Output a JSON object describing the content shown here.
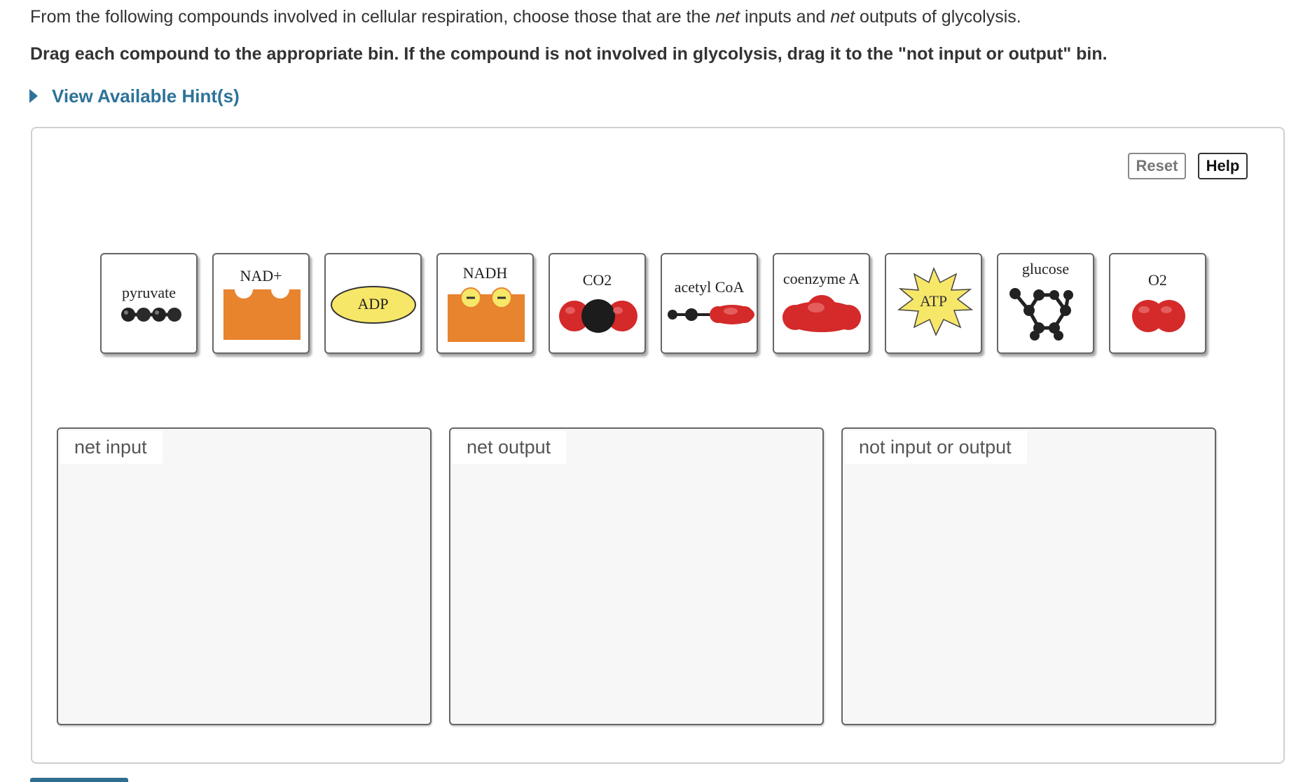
{
  "instructions": {
    "part1": "From the following compounds involved in cellular respiration, choose those that are the ",
    "net1": "net",
    "part2": " inputs and ",
    "net2": "net",
    "part3": " outputs of glycolysis.",
    "bold": "Drag each compound to the appropriate bin. If the compound is not involved in glycolysis, drag it to the \"not input or output\" bin."
  },
  "hint_link": "View Available Hint(s)",
  "buttons": {
    "reset": "Reset",
    "help": "Help"
  },
  "tiles": [
    {
      "label": "pyruvate",
      "icon": "pyruvate-molecule-icon"
    },
    {
      "label": "NAD+",
      "icon": "nad-plus-icon"
    },
    {
      "label": "ADP",
      "icon": "adp-oval-icon"
    },
    {
      "label": "NADH",
      "icon": "nadh-icon"
    },
    {
      "label": "CO2",
      "icon": "co2-molecule-icon"
    },
    {
      "label": "acetyl CoA",
      "icon": "acetyl-coa-icon"
    },
    {
      "label": "coenzyme A",
      "icon": "coenzyme-a-icon"
    },
    {
      "label": "ATP",
      "icon": "atp-starburst-icon"
    },
    {
      "label": "glucose",
      "icon": "glucose-ring-icon"
    },
    {
      "label": "O2",
      "icon": "o2-molecule-icon"
    }
  ],
  "bins": [
    {
      "label": "net input"
    },
    {
      "label": "net output"
    },
    {
      "label": "not input or output"
    }
  ],
  "colors": {
    "link": "#2e7399",
    "orange": "#e8832e",
    "red": "#d42a2a",
    "yellow": "#f7e769"
  }
}
